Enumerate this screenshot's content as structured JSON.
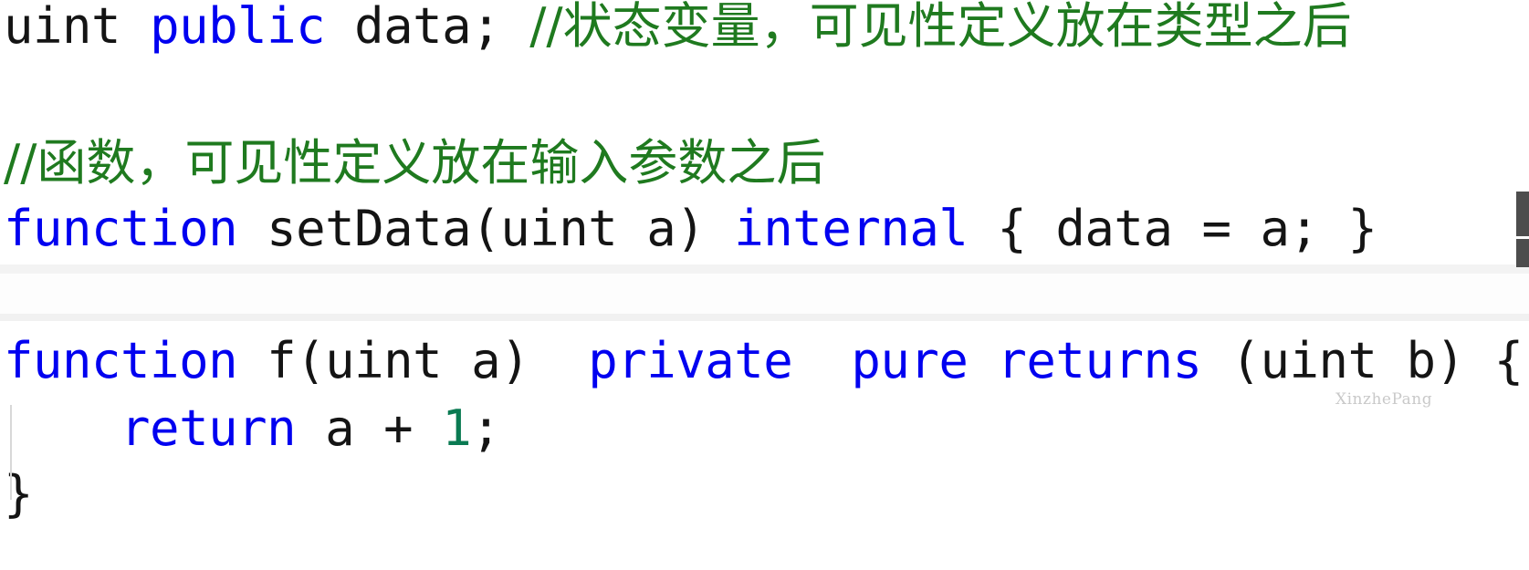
{
  "editor": {
    "language": "solidity",
    "colors": {
      "keyword": "#0000f0",
      "comment": "#1f7a1f",
      "number": "#0a7a52",
      "plain": "#141414",
      "background": "#ffffff",
      "separator": "#f3f3f3",
      "scrollbar": "#4d4d4d",
      "indent_guide": "#d8d8d8",
      "watermark": "#c9c9c9"
    },
    "watermark": "XinzhePang",
    "blocks": [
      {
        "id": "state-variable-block",
        "lines": [
          {
            "id": "line-state-var",
            "tokens": [
              {
                "text": "uint ",
                "kind": "plain"
              },
              {
                "text": "public",
                "kind": "keyword"
              },
              {
                "text": " data; ",
                "kind": "plain"
              },
              {
                "text": "//状态变量，可见性定义放在类型之后",
                "kind": "comment"
              }
            ]
          },
          {
            "id": "line-function-comment",
            "tokens": [
              {
                "text": "//函数，可见性定义放在输入参数之后",
                "kind": "comment"
              }
            ]
          },
          {
            "id": "line-setdata",
            "tokens": [
              {
                "text": "function",
                "kind": "keyword"
              },
              {
                "text": " setData(uint a) ",
                "kind": "plain"
              },
              {
                "text": "internal",
                "kind": "keyword"
              },
              {
                "text": " { data = a; }",
                "kind": "plain"
              }
            ]
          }
        ]
      },
      {
        "id": "function-f-block",
        "lines": [
          {
            "id": "line-function-f",
            "tokens": [
              {
                "text": "function",
                "kind": "keyword"
              },
              {
                "text": " f(uint a)  ",
                "kind": "plain"
              },
              {
                "text": "private",
                "kind": "keyword"
              },
              {
                "text": "  ",
                "kind": "plain"
              },
              {
                "text": "pure",
                "kind": "keyword"
              },
              {
                "text": " ",
                "kind": "plain"
              },
              {
                "text": "returns",
                "kind": "keyword"
              },
              {
                "text": " (uint b) {",
                "kind": "plain"
              }
            ]
          },
          {
            "id": "line-return",
            "tokens": [
              {
                "text": "    ",
                "kind": "plain"
              },
              {
                "text": "return",
                "kind": "keyword"
              },
              {
                "text": " a + ",
                "kind": "plain"
              },
              {
                "text": "1",
                "kind": "number"
              },
              {
                "text": ";",
                "kind": "plain"
              }
            ]
          },
          {
            "id": "line-close-brace",
            "tokens": [
              {
                "text": "}",
                "kind": "plain"
              }
            ]
          }
        ]
      }
    ],
    "plain_text": {
      "line_1": "uint public data; //状态变量，可见性定义放在类型之后",
      "line_2": "//函数，可见性定义放在输入参数之后",
      "line_3": "function setData(uint a) internal { data = a; }",
      "line_4": "function f(uint a)  private  pure returns (uint b) {",
      "line_5": "    return a + 1;",
      "line_6": "}"
    }
  }
}
